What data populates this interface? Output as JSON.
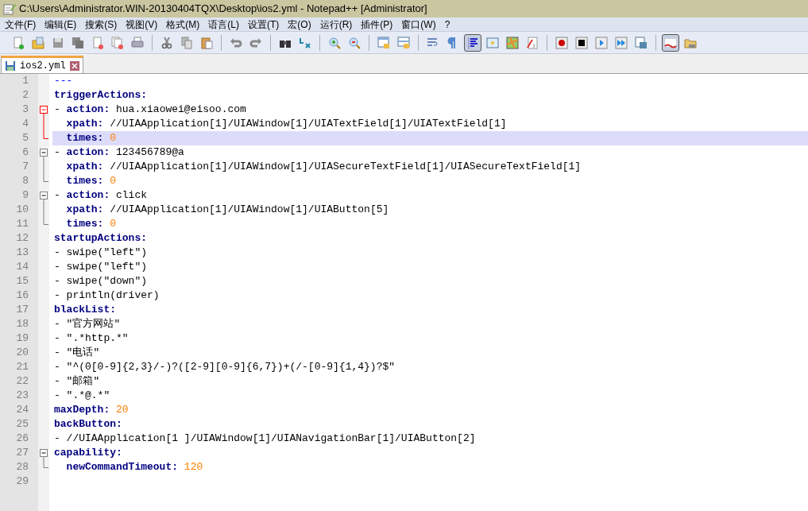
{
  "window": {
    "title": "C:\\Users\\Administrator.WIN-20130404TQX\\Desktop\\ios2.yml - Notepad++ [Administrator]"
  },
  "menu": [
    "文件(F)",
    "编辑(E)",
    "搜索(S)",
    "视图(V)",
    "格式(M)",
    "语言(L)",
    "设置(T)",
    "宏(O)",
    "运行(R)",
    "插件(P)",
    "窗口(W)",
    "?"
  ],
  "toolbar": [
    {
      "kind": "new",
      "pressed": false
    },
    {
      "kind": "open",
      "pressed": false
    },
    {
      "kind": "save",
      "pressed": false
    },
    {
      "kind": "save-all",
      "pressed": false
    },
    {
      "kind": "close",
      "pressed": false
    },
    {
      "kind": "close-all",
      "pressed": false
    },
    {
      "kind": "print",
      "pressed": false
    },
    {
      "kind": "sep"
    },
    {
      "kind": "cut",
      "pressed": false
    },
    {
      "kind": "copy",
      "pressed": false
    },
    {
      "kind": "paste",
      "pressed": false
    },
    {
      "kind": "sep"
    },
    {
      "kind": "undo",
      "pressed": false
    },
    {
      "kind": "redo",
      "pressed": false
    },
    {
      "kind": "sep"
    },
    {
      "kind": "find",
      "pressed": false
    },
    {
      "kind": "replace",
      "pressed": false
    },
    {
      "kind": "sep"
    },
    {
      "kind": "zoom-in",
      "pressed": false
    },
    {
      "kind": "zoom-out",
      "pressed": false
    },
    {
      "kind": "sep"
    },
    {
      "kind": "sync-v",
      "pressed": false
    },
    {
      "kind": "sync-h",
      "pressed": false
    },
    {
      "kind": "sep"
    },
    {
      "kind": "wrap",
      "pressed": false
    },
    {
      "kind": "pilcrow",
      "pressed": false
    },
    {
      "kind": "indent-guide",
      "pressed": true
    },
    {
      "kind": "lang",
      "pressed": false
    },
    {
      "kind": "map",
      "pressed": false
    },
    {
      "kind": "func",
      "pressed": false
    },
    {
      "kind": "sep"
    },
    {
      "kind": "record",
      "pressed": false
    },
    {
      "kind": "stop",
      "pressed": false
    },
    {
      "kind": "play",
      "pressed": false
    },
    {
      "kind": "play-multi",
      "pressed": false
    },
    {
      "kind": "save-macro",
      "pressed": false
    },
    {
      "kind": "sep"
    },
    {
      "kind": "spell",
      "pressed": true
    },
    {
      "kind": "folder",
      "pressed": false
    }
  ],
  "tabs": [
    {
      "label": "ios2.yml",
      "selected": true
    }
  ],
  "editor": {
    "lines": [
      {
        "number": "1",
        "kind": "plain",
        "highlighted": false,
        "tokens": [
          {
            "kind": "marker",
            "text": "---"
          }
        ]
      },
      {
        "number": "2",
        "kind": "plain",
        "highlighted": false,
        "tokens": [
          {
            "kind": "key",
            "text": "triggerActions:"
          }
        ]
      },
      {
        "number": "3",
        "kind": "fold-start",
        "fold_active": true,
        "highlighted": false,
        "tokens": [
          {
            "kind": "plain",
            "text": "- "
          },
          {
            "kind": "key",
            "text": "action:"
          },
          {
            "kind": "plain",
            "text": " hua.xiaowei@eisoo.com"
          }
        ]
      },
      {
        "number": "4",
        "kind": "fold-body",
        "fold_active": true,
        "highlighted": false,
        "tokens": [
          {
            "kind": "key",
            "text": "  xpath:"
          },
          {
            "kind": "plain",
            "text": " //UIAApplication[1]/UIAWindow[1]/UIATextField[1]/UIATextField[1]"
          }
        ]
      },
      {
        "number": "5",
        "kind": "fold-end",
        "fold_active": true,
        "highlighted": true,
        "tokens": [
          {
            "kind": "key",
            "text": "  times: "
          },
          {
            "kind": "number",
            "text": "0"
          }
        ]
      },
      {
        "number": "6",
        "kind": "fold-start",
        "fold_active": false,
        "highlighted": false,
        "tokens": [
          {
            "kind": "plain",
            "text": "- "
          },
          {
            "kind": "key",
            "text": "action:"
          },
          {
            "kind": "plain",
            "text": " 123456789@a"
          }
        ]
      },
      {
        "number": "7",
        "kind": "fold-body",
        "fold_active": false,
        "highlighted": false,
        "tokens": [
          {
            "kind": "key",
            "text": "  xpath:"
          },
          {
            "kind": "plain",
            "text": " //UIAApplication[1]/UIAWindow[1]/UIASecureTextField[1]/UIASecureTextField[1]"
          }
        ]
      },
      {
        "number": "8",
        "kind": "fold-end",
        "fold_active": false,
        "highlighted": false,
        "tokens": [
          {
            "kind": "key",
            "text": "  times: "
          },
          {
            "kind": "number",
            "text": "0"
          }
        ]
      },
      {
        "number": "9",
        "kind": "fold-start",
        "fold_active": false,
        "highlighted": false,
        "tokens": [
          {
            "kind": "plain",
            "text": "- "
          },
          {
            "kind": "key",
            "text": "action:"
          },
          {
            "kind": "plain",
            "text": " click"
          }
        ]
      },
      {
        "number": "10",
        "kind": "fold-body",
        "fold_active": false,
        "highlighted": false,
        "tokens": [
          {
            "kind": "key",
            "text": "  xpath:"
          },
          {
            "kind": "plain",
            "text": " //UIAApplication[1]/UIAWindow[1]/UIAButton[5]"
          }
        ]
      },
      {
        "number": "11",
        "kind": "fold-end",
        "fold_active": false,
        "highlighted": false,
        "tokens": [
          {
            "kind": "key",
            "text": "  times: "
          },
          {
            "kind": "number",
            "text": "0"
          }
        ]
      },
      {
        "number": "12",
        "kind": "plain",
        "highlighted": false,
        "tokens": [
          {
            "kind": "key",
            "text": "startupActions:"
          }
        ]
      },
      {
        "number": "13",
        "kind": "plain",
        "highlighted": false,
        "tokens": [
          {
            "kind": "plain",
            "text": "- swipe(\"left\")"
          }
        ]
      },
      {
        "number": "14",
        "kind": "plain",
        "highlighted": false,
        "tokens": [
          {
            "kind": "plain",
            "text": "- swipe(\"left\")"
          }
        ]
      },
      {
        "number": "15",
        "kind": "plain",
        "highlighted": false,
        "tokens": [
          {
            "kind": "plain",
            "text": "- swipe(\"down\")"
          }
        ]
      },
      {
        "number": "16",
        "kind": "plain",
        "highlighted": false,
        "tokens": [
          {
            "kind": "plain",
            "text": "- println(driver)"
          }
        ]
      },
      {
        "number": "17",
        "kind": "plain",
        "highlighted": false,
        "tokens": [
          {
            "kind": "key",
            "text": "blackList:"
          }
        ]
      },
      {
        "number": "18",
        "kind": "plain",
        "highlighted": false,
        "tokens": [
          {
            "kind": "plain",
            "text": "- \"官方网站\""
          }
        ]
      },
      {
        "number": "19",
        "kind": "plain",
        "highlighted": false,
        "tokens": [
          {
            "kind": "plain",
            "text": "- \".*http.*\""
          }
        ]
      },
      {
        "number": "20",
        "kind": "plain",
        "highlighted": false,
        "tokens": [
          {
            "kind": "plain",
            "text": "- \"电话\""
          }
        ]
      },
      {
        "number": "21",
        "kind": "plain",
        "highlighted": false,
        "tokens": [
          {
            "kind": "plain",
            "text": "- \"^(0[0-9]{2,3}/-)?([2-9][0-9]{6,7})+(/-[0-9]{1,4})?$\""
          }
        ]
      },
      {
        "number": "22",
        "kind": "plain",
        "highlighted": false,
        "tokens": [
          {
            "kind": "plain",
            "text": "- \"邮箱\""
          }
        ]
      },
      {
        "number": "23",
        "kind": "plain",
        "highlighted": false,
        "tokens": [
          {
            "kind": "plain",
            "text": "- \".*@.*\""
          }
        ]
      },
      {
        "number": "24",
        "kind": "plain",
        "highlighted": false,
        "tokens": [
          {
            "kind": "key",
            "text": "maxDepth: "
          },
          {
            "kind": "number",
            "text": "20"
          }
        ]
      },
      {
        "number": "25",
        "kind": "plain",
        "highlighted": false,
        "tokens": [
          {
            "kind": "key",
            "text": "backButton:"
          }
        ]
      },
      {
        "number": "26",
        "kind": "plain",
        "highlighted": false,
        "tokens": [
          {
            "kind": "plain",
            "text": "- //UIAApplication[1 ]/UIAWindow[1]/UIANavigationBar[1]/UIAButton[2]"
          }
        ]
      },
      {
        "number": "27",
        "kind": "fold-start",
        "fold_active": false,
        "highlighted": false,
        "tokens": [
          {
            "kind": "key",
            "text": "capability:"
          }
        ]
      },
      {
        "number": "28",
        "kind": "fold-end",
        "fold_active": false,
        "highlighted": false,
        "tokens": [
          {
            "kind": "key",
            "text": "  newCommandTimeout: "
          },
          {
            "kind": "number",
            "text": "120"
          }
        ]
      },
      {
        "number": "29",
        "kind": "plain",
        "highlighted": false
      }
    ]
  }
}
